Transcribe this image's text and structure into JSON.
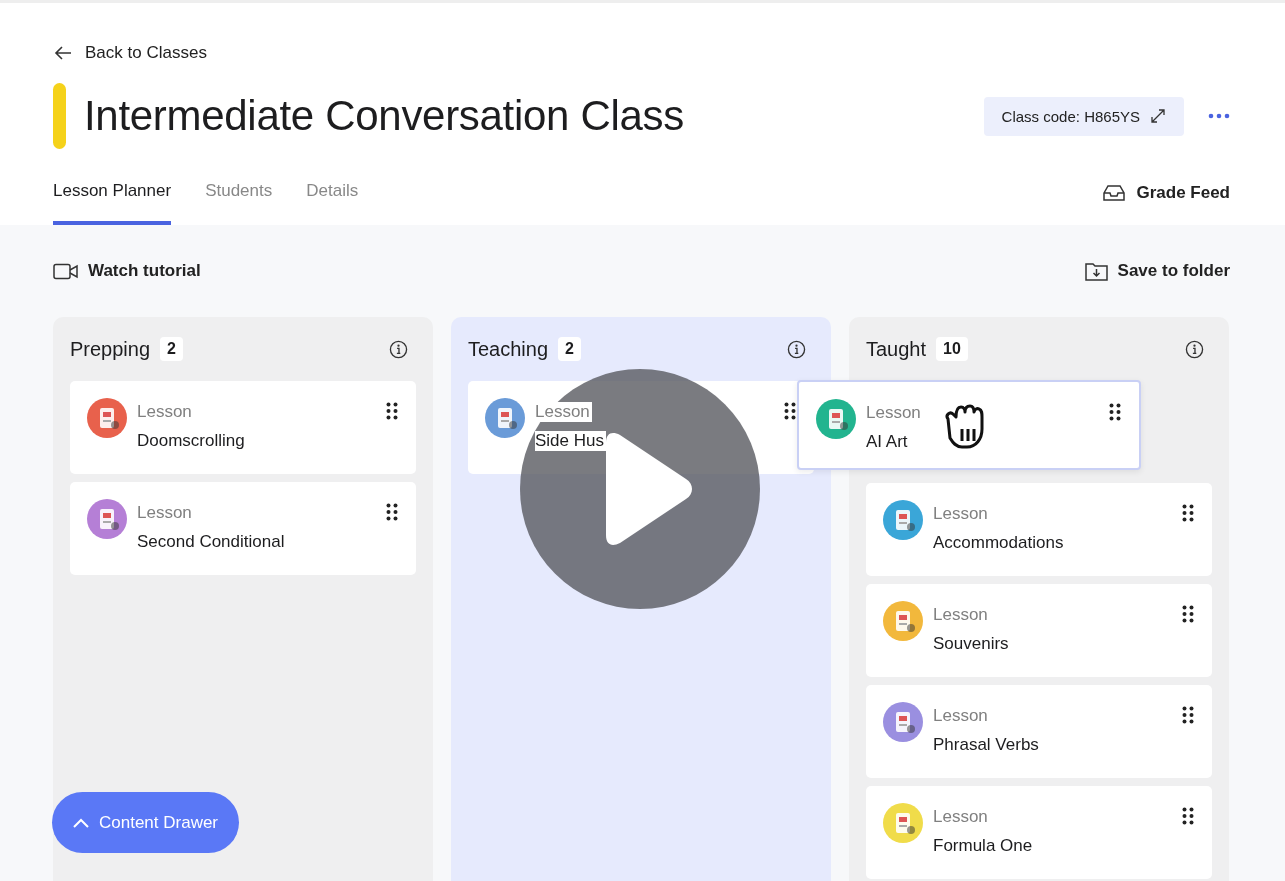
{
  "back_link": "Back to Classes",
  "class_title": "Intermediate Conversation Class",
  "class_code": "Class code: H865YS",
  "tabs": [
    {
      "label": "Lesson Planner",
      "selected": true
    },
    {
      "label": "Students",
      "selected": false
    },
    {
      "label": "Details",
      "selected": false
    }
  ],
  "grade_feed": "Grade Feed",
  "watch_tutorial": "Watch tutorial",
  "save_to_folder": "Save to folder",
  "columns": [
    {
      "title": "Prepping",
      "count": "2",
      "selected": false,
      "cards": [
        {
          "type": "Lesson",
          "title": "Doomscrolling",
          "color": "#e8614c"
        },
        {
          "type": "Lesson",
          "title": "Second Conditional",
          "color": "#b57fd6"
        }
      ]
    },
    {
      "title": "Teaching",
      "count": "2",
      "selected": true,
      "cards": [
        {
          "type": "Lesson",
          "title": "Side Hus",
          "color": "#6a9bd8"
        }
      ]
    },
    {
      "title": "Taught",
      "count": "10",
      "selected": false,
      "cards": [
        {
          "type": "Lesson",
          "title": "Accommodations",
          "color": "#3aa6d8"
        },
        {
          "type": "Lesson",
          "title": "Souvenirs",
          "color": "#f2b83c"
        },
        {
          "type": "Lesson",
          "title": "Phrasal Verbs",
          "color": "#9a8fe0"
        },
        {
          "type": "Lesson",
          "title": "Formula One",
          "color": "#f0dc4a"
        }
      ]
    }
  ],
  "dragged_card": {
    "type": "Lesson",
    "title": "AI Art",
    "color": "#22b48f"
  },
  "content_drawer": "Content Drawer"
}
